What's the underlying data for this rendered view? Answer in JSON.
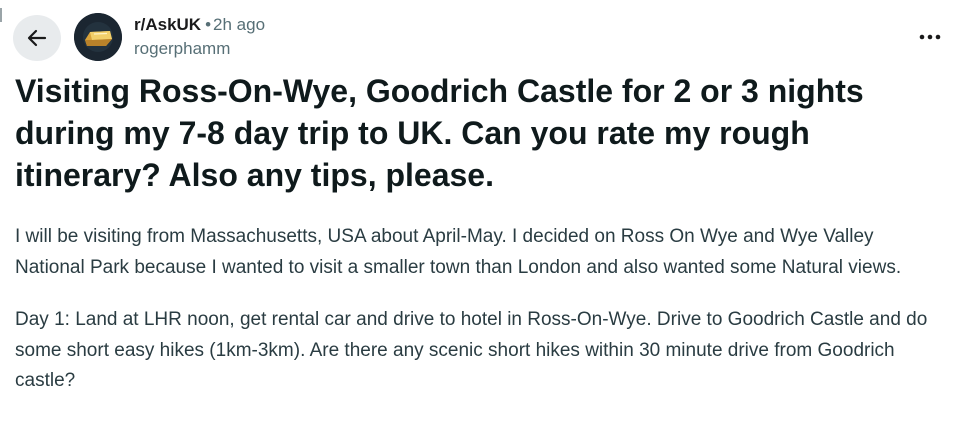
{
  "post": {
    "subreddit": "r/AskUK",
    "separator": "•",
    "time_ago": "2h ago",
    "author": "rogerphamm",
    "title": "Visiting Ross-On-Wye, Goodrich Castle for 2 or 3 nights during my 7-8 day trip to UK. Can you rate my rough itinerary? Also any tips, please.",
    "paragraphs": [
      "I will be visiting from Massachusetts, USA about April-May. I decided on Ross On Wye and Wye Valley National Park because I wanted to visit a smaller town than London and also wanted some Natural views.",
      "Day 1: Land at LHR noon, get rental car and drive to hotel in Ross-On-Wye. Drive to Goodrich Castle and do some short easy hikes (1km-3km). Are there any scenic short hikes within 30 minute drive from Goodrich castle?"
    ]
  },
  "icons": {
    "back": "arrow-left-icon",
    "more": "more-horizontal-icon",
    "avatar": "gold-bar-avatar"
  },
  "colors": {
    "text_primary": "#0f1a1c",
    "text_body": "#2a3c42",
    "text_meta": "#576f76",
    "back_button_bg": "#e8ebed",
    "avatar_bg": "#1b2631"
  }
}
